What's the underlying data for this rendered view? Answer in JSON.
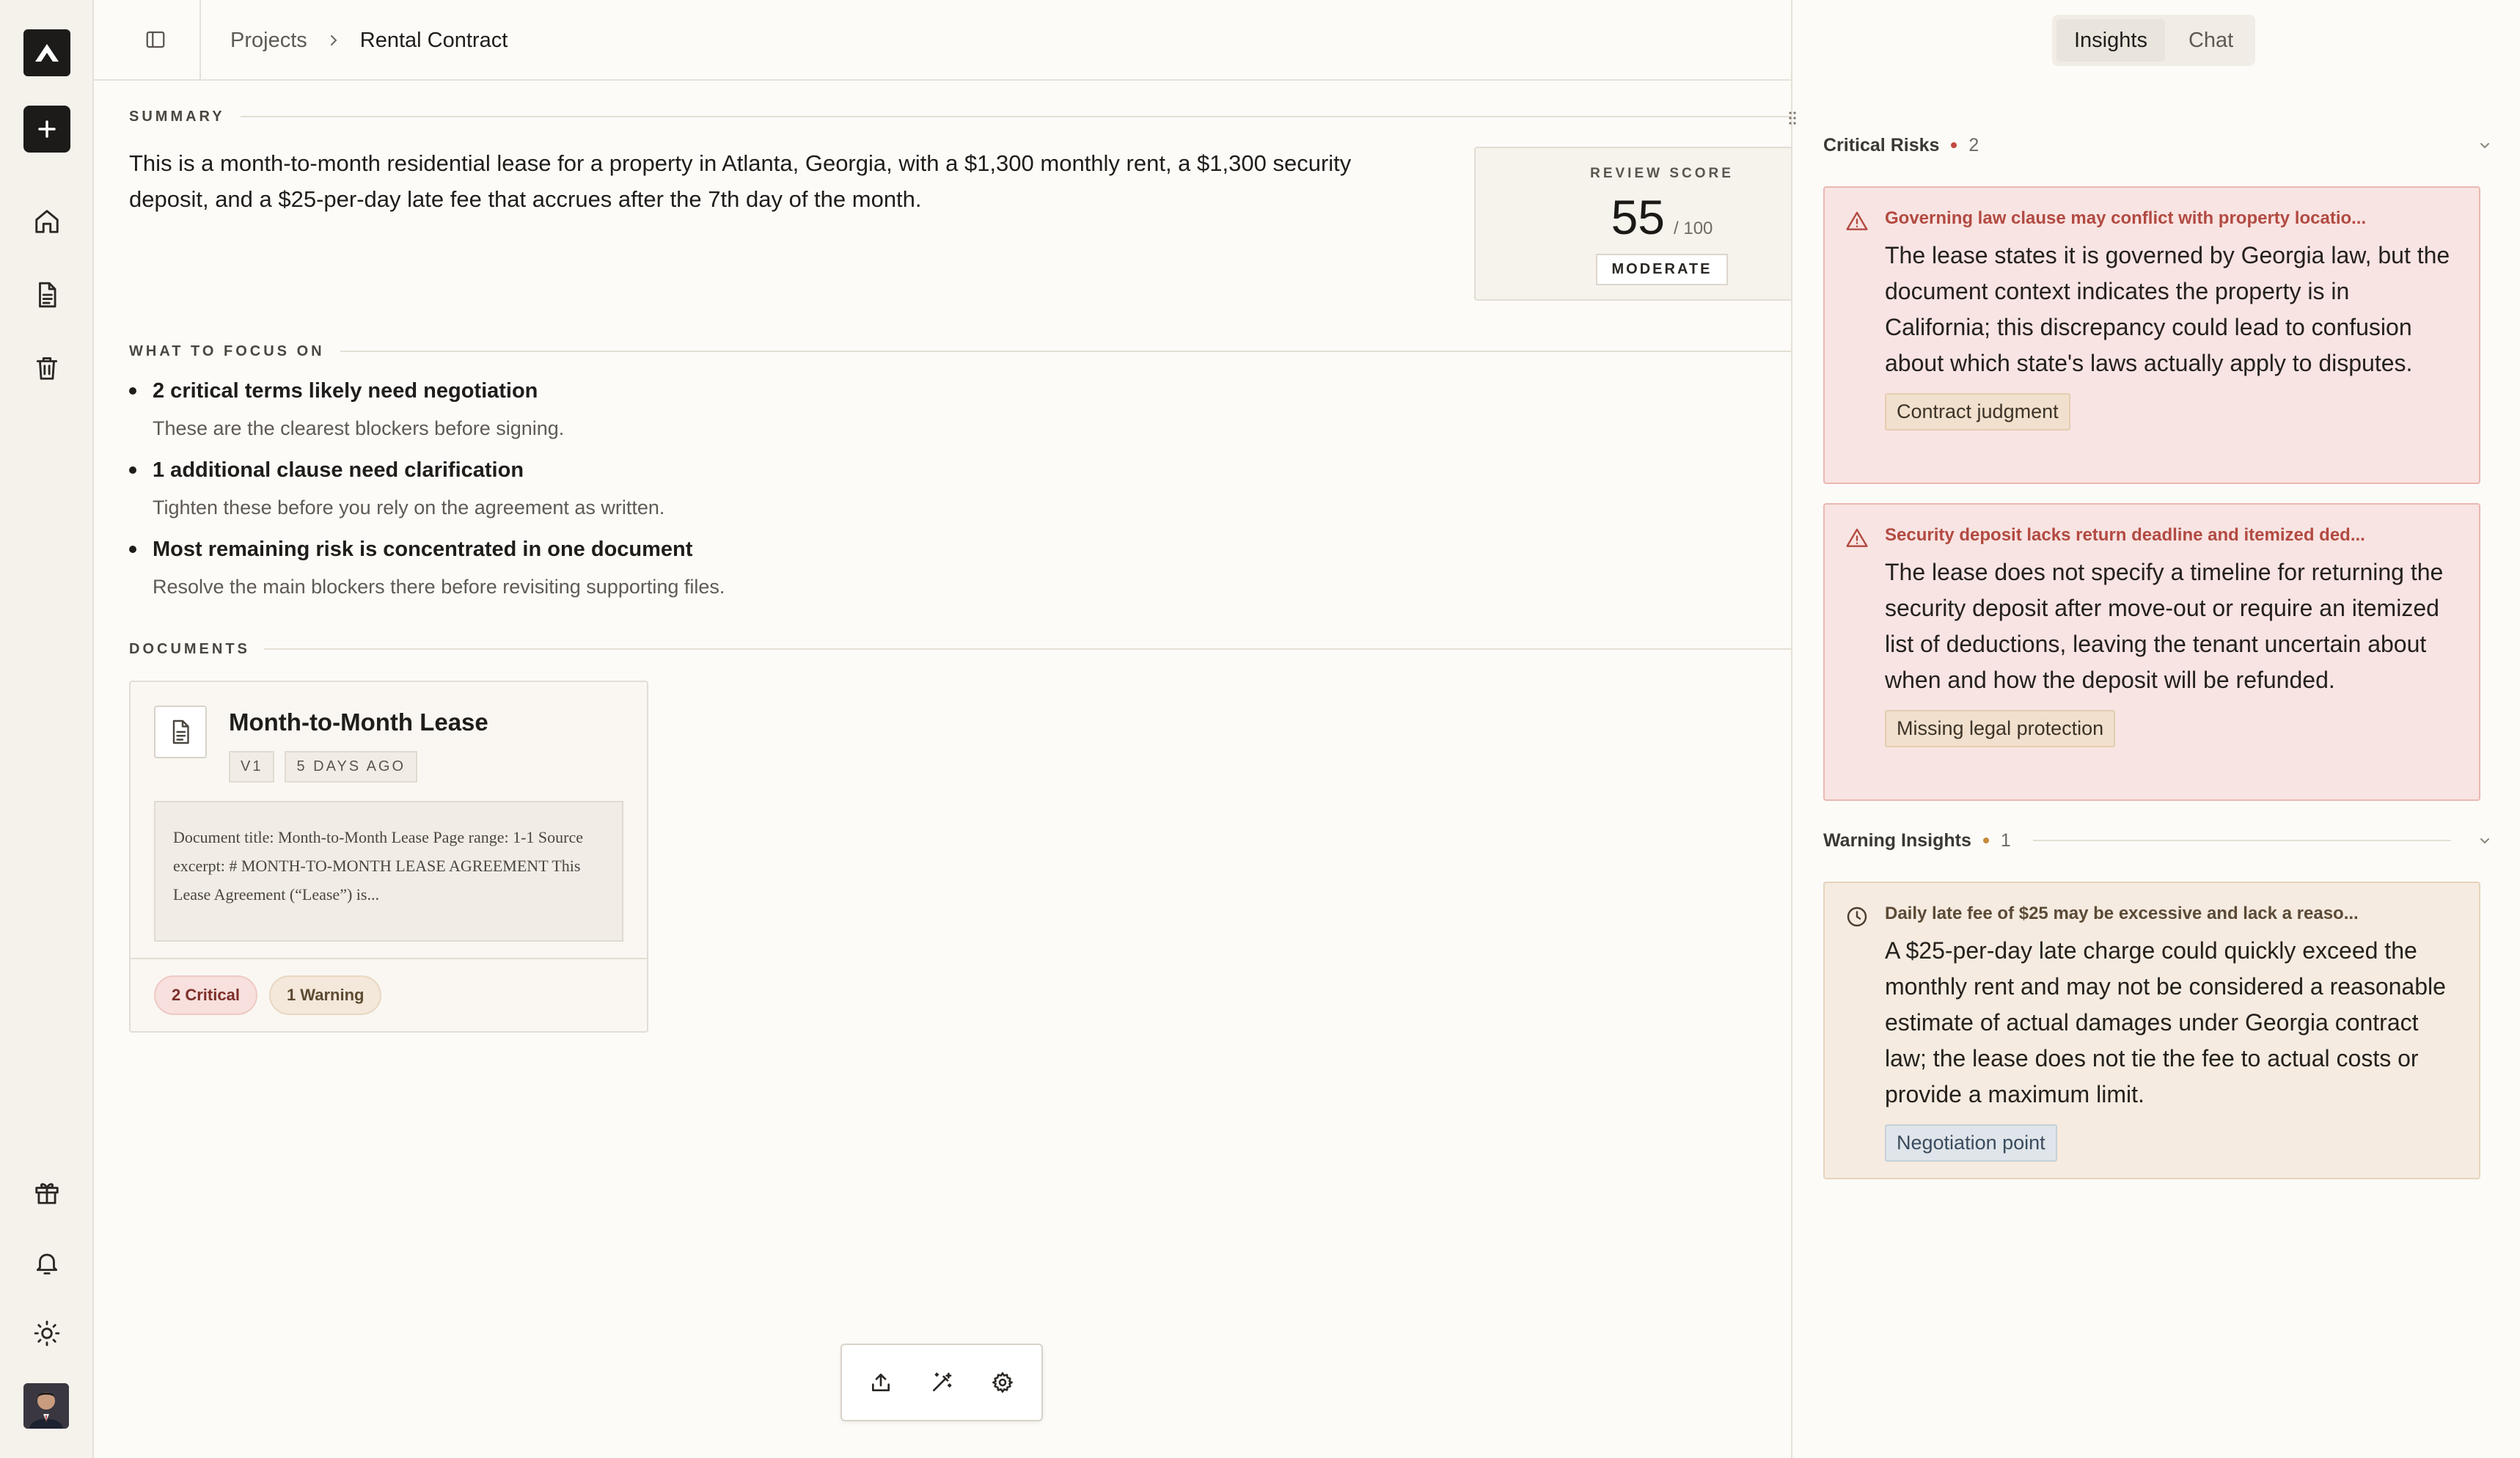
{
  "breadcrumb": {
    "root": "Projects",
    "current": "Rental Contract"
  },
  "colors": {
    "accent_critical": "#c24a40",
    "accent_warning": "#c68a3a",
    "dark": "#1c1b19"
  },
  "rail": {
    "icons": [
      "logo-icon",
      "plus-icon",
      "home-icon",
      "document-icon",
      "trash-icon",
      "gift-icon",
      "bell-icon",
      "sun-icon"
    ]
  },
  "summary": {
    "label": "SUMMARY",
    "text": "This is a month-to-month residential lease for a property in Atlanta, Georgia, with a $1,300 monthly rent, a $1,300 security deposit, and a $25-per-day late fee that accrues after the 7th day of the month."
  },
  "score": {
    "label": "REVIEW SCORE",
    "value": "55",
    "max": "/ 100",
    "badge": "MODERATE"
  },
  "focus": {
    "label": "WHAT TO FOCUS ON",
    "items": [
      {
        "title": "2 critical terms likely need negotiation",
        "sub": "These are the clearest blockers before signing."
      },
      {
        "title": "1 additional clause need clarification",
        "sub": "Tighten these before you rely on the agreement as written."
      },
      {
        "title": "Most remaining risk is concentrated in one document",
        "sub": "Resolve the main blockers there before revisiting supporting files."
      }
    ]
  },
  "documents": {
    "label": "DOCUMENTS",
    "items": [
      {
        "title": "Month-to-Month Lease",
        "version": "V1",
        "age": "5 DAYS AGO",
        "excerpt": "Document title: Month-to-Month Lease Page range: 1-1 Source excerpt: # MONTH-TO-MONTH LEASE AGREEMENT This Lease Agreement (“Lease”) is...",
        "critical": "2 Critical",
        "warning": "1 Warning"
      }
    ]
  },
  "tabs": {
    "insights": "Insights",
    "chat": "Chat"
  },
  "critical_group": {
    "title": "Critical Risks",
    "count": "2",
    "items": [
      {
        "title": "Governing law clause may conflict with property locatio...",
        "body": "The lease states it is governed by Georgia law, but the document context indicates the property is in California; this discrepancy could lead to confusion about which state's laws actually apply to disputes.",
        "tag": "Contract judgment"
      },
      {
        "title": "Security deposit lacks return deadline and itemized ded...",
        "body": "The lease does not specify a timeline for returning the security deposit after move-out or require an itemized list of deductions, leaving the tenant uncertain about when and how the deposit will be refunded.",
        "tag": "Missing legal protection"
      }
    ]
  },
  "warning_group": {
    "title": "Warning Insights",
    "count": "1",
    "items": [
      {
        "title": "Daily late fee of $25 may be excessive and lack a reaso...",
        "body": "A $25-per-day late charge could quickly exceed the monthly rent and may not be considered a reasonable estimate of actual damages under Georgia contract law; the lease does not tie the fee to actual costs or provide a maximum limit.",
        "tag": "Negotiation point"
      }
    ]
  }
}
